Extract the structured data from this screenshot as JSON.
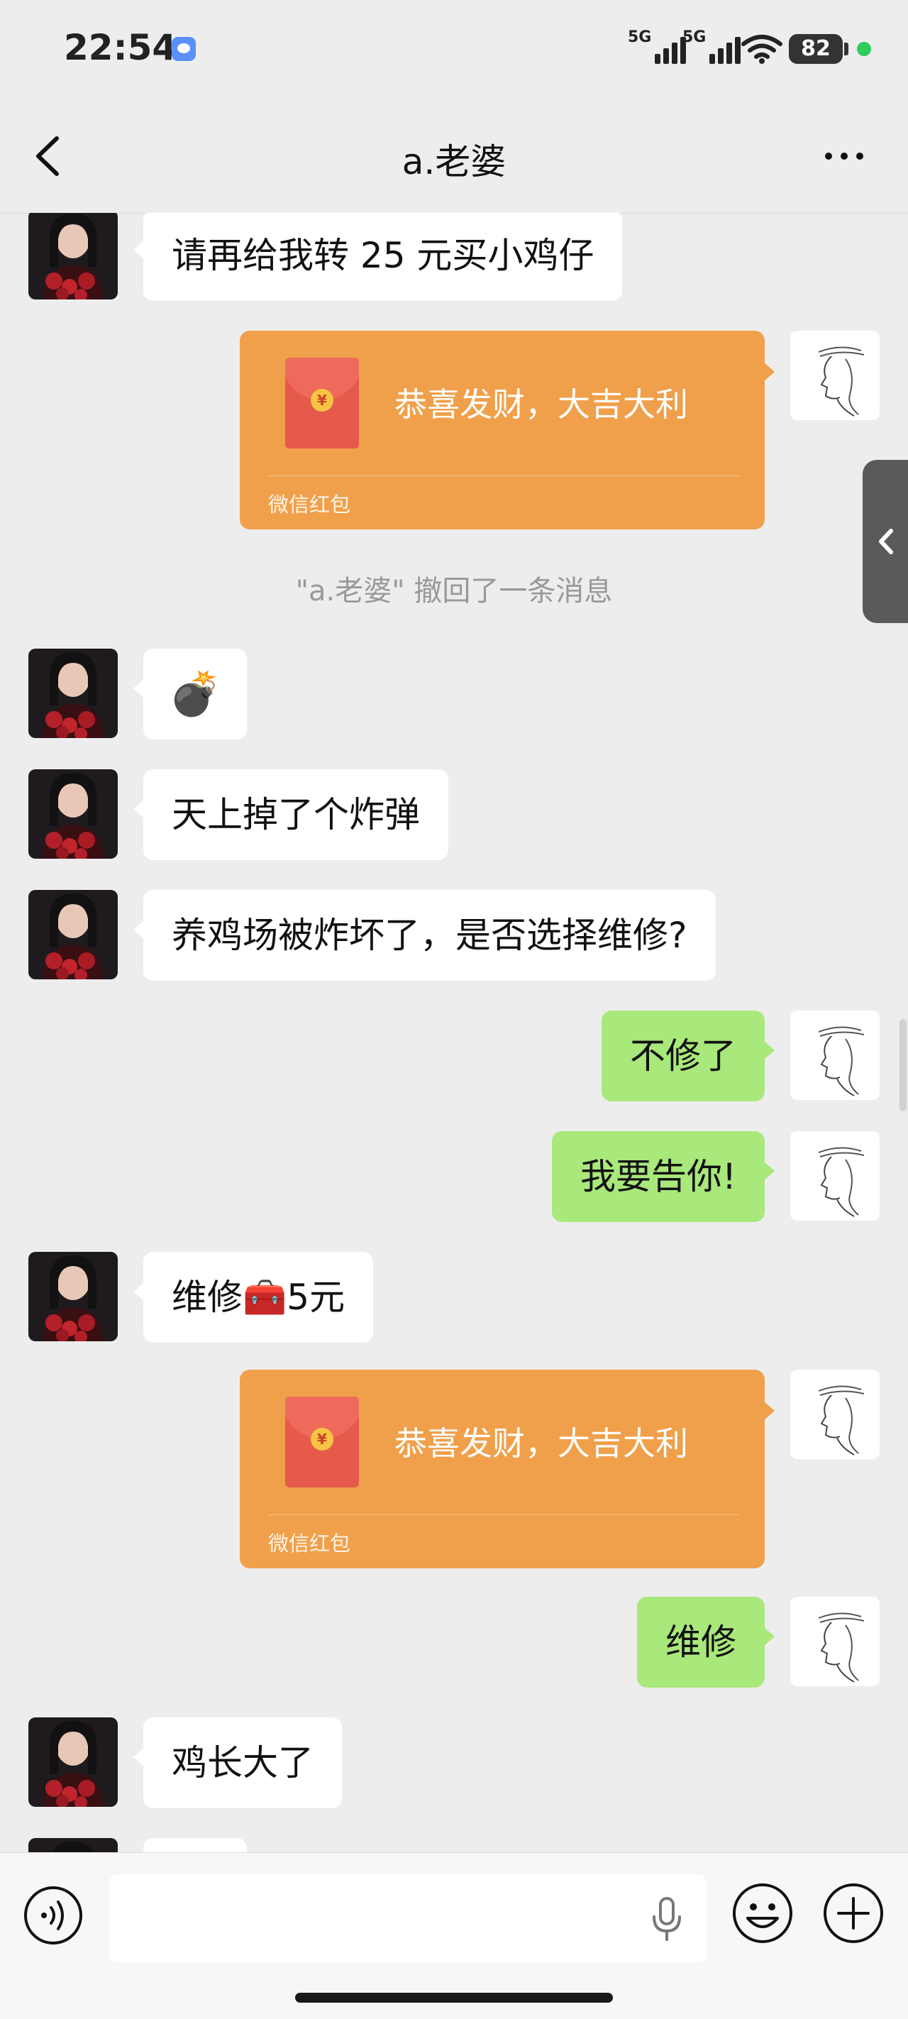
{
  "status_bar": {
    "time": "22:54",
    "signal_1": "5G",
    "signal_2": "5G",
    "battery": "82",
    "icons": [
      "wechat-app-icon",
      "signal-icon",
      "wifi-icon",
      "battery-icon"
    ]
  },
  "nav": {
    "title": "a.老婆",
    "icons": [
      "back-icon",
      "more-icon"
    ]
  },
  "chat": {
    "messages": [
      {
        "side": "left",
        "type": "text",
        "text": "请再给我转 25 元买小鸡仔"
      },
      {
        "side": "right",
        "type": "red_packet",
        "title": "恭喜发财，大吉大利",
        "footer": "微信红包"
      },
      {
        "side": "system",
        "type": "system",
        "text": "\"a.老婆\" 撤回了一条消息"
      },
      {
        "side": "left",
        "type": "emoji",
        "text": "💣"
      },
      {
        "side": "left",
        "type": "text",
        "text": "天上掉了个炸弹"
      },
      {
        "side": "left",
        "type": "text",
        "text": "养鸡场被炸坏了，是否选择维修?"
      },
      {
        "side": "right",
        "type": "text",
        "text": "不修了"
      },
      {
        "side": "right",
        "type": "text",
        "text": "我要告你!"
      },
      {
        "side": "left",
        "type": "text",
        "text": "维修🧰5元"
      },
      {
        "side": "right",
        "type": "red_packet",
        "title": "恭喜发财，大吉大利",
        "footer": "微信红包"
      },
      {
        "side": "right",
        "type": "text",
        "text": "维修"
      },
      {
        "side": "left",
        "type": "text",
        "text": "鸡长大了"
      }
    ]
  },
  "input_bar": {
    "placeholder": "",
    "icons": [
      "voice-icon",
      "mic-icon",
      "emoji-icon",
      "plus-icon"
    ]
  },
  "colors": {
    "background": "#ededed",
    "bubble_green": "#a9e87a",
    "bubble_white": "#ffffff",
    "red_packet": "#f0a04b",
    "system_text": "#999999"
  }
}
